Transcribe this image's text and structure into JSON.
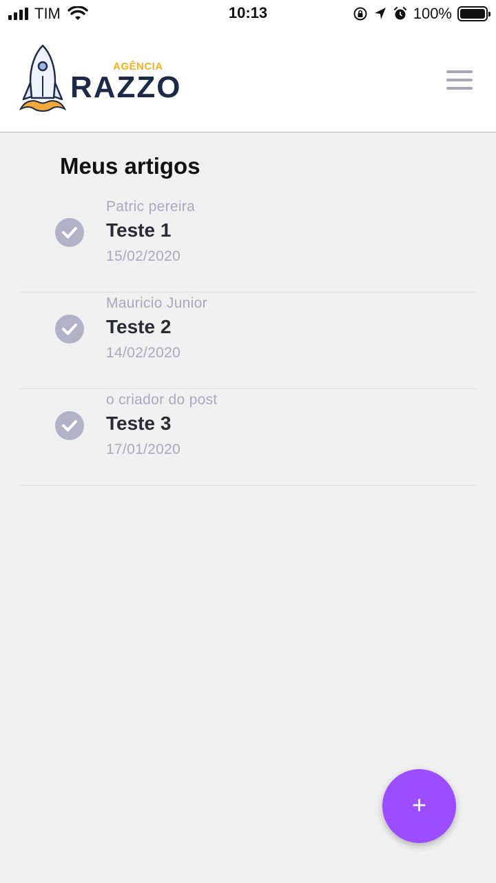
{
  "status": {
    "carrier": "TIM",
    "time": "10:13",
    "battery": "100%"
  },
  "header": {
    "logo_small": "AGÊNCIA",
    "logo_main": "RAZZO"
  },
  "page": {
    "title": "Meus artigos"
  },
  "articles": [
    {
      "author": "Patric pereira",
      "title": "Teste 1",
      "date": "15/02/2020"
    },
    {
      "author": "Mauricio Junior",
      "title": "Teste 2",
      "date": "14/02/2020"
    },
    {
      "author": "o criador do post",
      "title": "Teste 3",
      "date": "17/01/2020"
    }
  ],
  "fab": {
    "label": "+"
  },
  "colors": {
    "accent": "#9b4dff",
    "check": "#b3b1c8",
    "muted_text": "#a9a8bd",
    "logo_text": "#1d2a47",
    "logo_accent": "#f5b021"
  }
}
